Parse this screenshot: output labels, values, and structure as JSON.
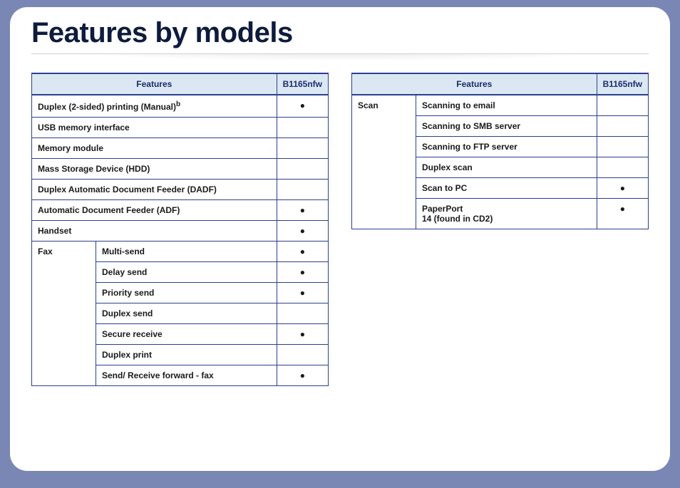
{
  "title": "Features by models",
  "model_header": "B1165nfw",
  "features_header": "Features",
  "dot": "●",
  "footnote_b": "b",
  "left_simple": [
    {
      "label": "Duplex (2-sided) printing (Manual)",
      "footnote": true,
      "value": "●"
    },
    {
      "label": "USB memory interface",
      "value": ""
    },
    {
      "label": "Memory module",
      "value": ""
    },
    {
      "label": "Mass Storage Device (HDD)",
      "value": ""
    },
    {
      "label": "Duplex Automatic Document Feeder (DADF)",
      "value": ""
    },
    {
      "label": "Automatic Document Feeder (ADF)",
      "value": "●"
    },
    {
      "label": "Handset",
      "value": "●"
    }
  ],
  "left_group": {
    "category": "Fax",
    "items": [
      {
        "label": "Multi-send",
        "value": "●"
      },
      {
        "label": "Delay send",
        "value": "●"
      },
      {
        "label": "Priority send",
        "value": "●"
      },
      {
        "label": "Duplex send",
        "value": ""
      },
      {
        "label": "Secure receive",
        "value": "●"
      },
      {
        "label": "Duplex print",
        "value": ""
      },
      {
        "label": "Send/ Receive forward - fax",
        "value": "●"
      }
    ]
  },
  "right_group": {
    "category": "Scan",
    "items": [
      {
        "label": "Scanning to email",
        "value": ""
      },
      {
        "label": "Scanning to SMB server",
        "value": ""
      },
      {
        "label": "Scanning to FTP server",
        "value": ""
      },
      {
        "label": "Duplex scan",
        "value": ""
      },
      {
        "label": "Scan to PC",
        "value": "●"
      },
      {
        "label": "PaperPort",
        "label2": "14 (found in CD2)",
        "value": "●"
      }
    ]
  }
}
